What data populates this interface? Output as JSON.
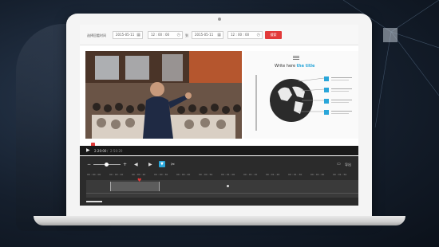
{
  "toolbar": {
    "range_label": "选择回看时间",
    "start_date": "2015-05-11",
    "start_time": "12 : 00 : 00",
    "to_label": "到",
    "end_date": "2015-05-11",
    "end_time": "12 : 00 : 00",
    "query_button": "搜索",
    "calendar_icon": "calendar-icon",
    "clock_icon": "clock-icon"
  },
  "slide": {
    "title_prefix": "Write here ",
    "title_highlight": "the title",
    "accent_color": "#2aa6d9"
  },
  "player": {
    "current_time": "2:20:00",
    "total_time": "2:50:20",
    "play_icon": "play-icon"
  },
  "editor_tools": {
    "zoom_out": "−",
    "zoom_in": "+",
    "prev_icon": "step-back-icon",
    "next_icon": "step-forward-icon",
    "marker_icon": "marker-icon",
    "cut_icon": "scissors-icon",
    "export_label": "导出"
  },
  "timeline": {
    "ticks": [
      "00 : 00 : 00",
      "00 : 00 : 10",
      "00 : 00 : 20",
      "00 : 00 : 30",
      "00 : 00 : 40",
      "00 : 00 : 50",
      "00 : 01 : 00",
      "00 : 01 : 10",
      "00 : 01 : 20",
      "00 : 01 : 30",
      "00 : 01 : 40",
      "00 : 01 : 50"
    ],
    "selection_color": "#e23a3a"
  }
}
